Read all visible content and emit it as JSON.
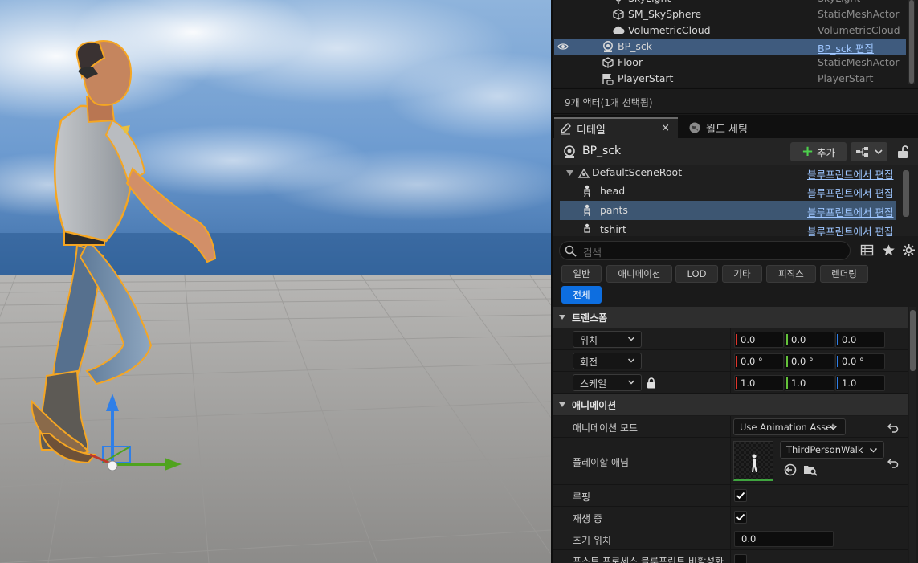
{
  "outliner": {
    "rows": [
      {
        "name": "SkyLight",
        "type": "SkyLight",
        "icon": "skylight-icon",
        "selected": false
      },
      {
        "name": "SM_SkySphere",
        "type": "StaticMeshActor",
        "icon": "static-mesh-icon",
        "selected": false
      },
      {
        "name": "VolumetricCloud",
        "type": "VolumetricCloud",
        "icon": "cloud-icon",
        "selected": false
      },
      {
        "name": "BP_sck",
        "type": "BP_sck 편집",
        "icon": "blueprint-actor-icon",
        "selected": true
      },
      {
        "name": "Floor",
        "type": "StaticMeshActor",
        "icon": "static-mesh-icon",
        "selected": false
      },
      {
        "name": "PlayerStart",
        "type": "PlayerStart",
        "icon": "player-start-icon",
        "selected": false
      }
    ],
    "status": "9개 액터(1개 선택됨)"
  },
  "tabs": {
    "details": "디테일",
    "world_settings": "월드 세팅",
    "close": "×"
  },
  "details": {
    "actor_name": "BP_sck",
    "add_label": "추가",
    "components": [
      {
        "name": "DefaultSceneRoot",
        "edit": "블루프린트에서 편집",
        "icon": "scene-root-icon"
      },
      {
        "name": "head",
        "edit": "블루프린트에서 편집",
        "icon": "skeletal-mesh-icon"
      },
      {
        "name": "pants",
        "edit": "블루프린트에서 편집",
        "icon": "skeletal-mesh-icon"
      },
      {
        "name": "tshirt",
        "edit": "블루프린트에서 편집",
        "icon": "skeletal-mesh-icon"
      }
    ],
    "search_placeholder": "검색",
    "filters": [
      "일반",
      "애니메이션",
      "LOD",
      "기타",
      "피직스",
      "렌더링",
      "전체"
    ],
    "active_filter": "전체"
  },
  "transform": {
    "category": "트랜스폼",
    "location": {
      "label": "위치",
      "x": "0.0",
      "y": "0.0",
      "z": "0.0"
    },
    "rotation": {
      "label": "회전",
      "x": "0.0 °",
      "y": "0.0 °",
      "z": "0.0 °"
    },
    "scale": {
      "label": "스케일",
      "x": "1.0",
      "y": "1.0",
      "z": "1.0"
    }
  },
  "animation": {
    "category": "애니메이션",
    "mode_label": "애니메이션 모드",
    "mode_value": "Use Animation Asset",
    "anim_label": "플레이할 애님",
    "anim_value": "ThirdPersonWalk",
    "looping_label": "루핑",
    "looping": true,
    "playing_label": "재생 중",
    "playing": true,
    "initial_pos_label": "초기 위치",
    "initial_pos_value": "0.0",
    "disable_post_label": "포스트 프로세스 블루프린트 비활성화",
    "disable_post": false
  },
  "colors": {
    "axis_x": "#e0352b",
    "axis_y": "#64c23a",
    "axis_z": "#2f7fe8",
    "selection": "#3f5b7e",
    "accent": "#0d6ee0",
    "outline": "#f5a623"
  }
}
